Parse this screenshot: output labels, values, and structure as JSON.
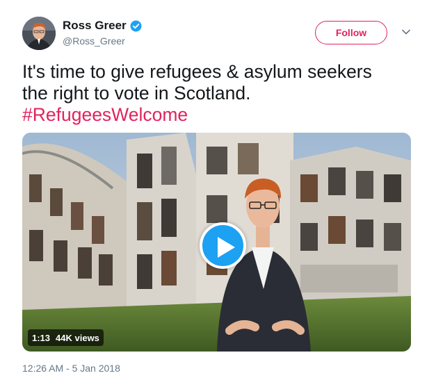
{
  "author": {
    "display_name": "Ross Greer",
    "handle": "@Ross_Greer",
    "verified": true,
    "avatar_icon": "profile-photo"
  },
  "follow_button": {
    "label": "Follow",
    "color": "#e0245e"
  },
  "menu_icon": "chevron-down-icon",
  "tweet": {
    "text_line_1": "It's time to give refugees & asylum seekers",
    "text_line_2": "the right to vote in Scotland.",
    "hashtag": "#RefugeesWelcome",
    "hashtag_color": "#e0245e"
  },
  "video": {
    "duration": "1:13",
    "views": "44K views",
    "play_icon": "play-icon",
    "play_color": "#1da1f2"
  },
  "timestamp": "12:26 AM - 5 Jan 2018"
}
